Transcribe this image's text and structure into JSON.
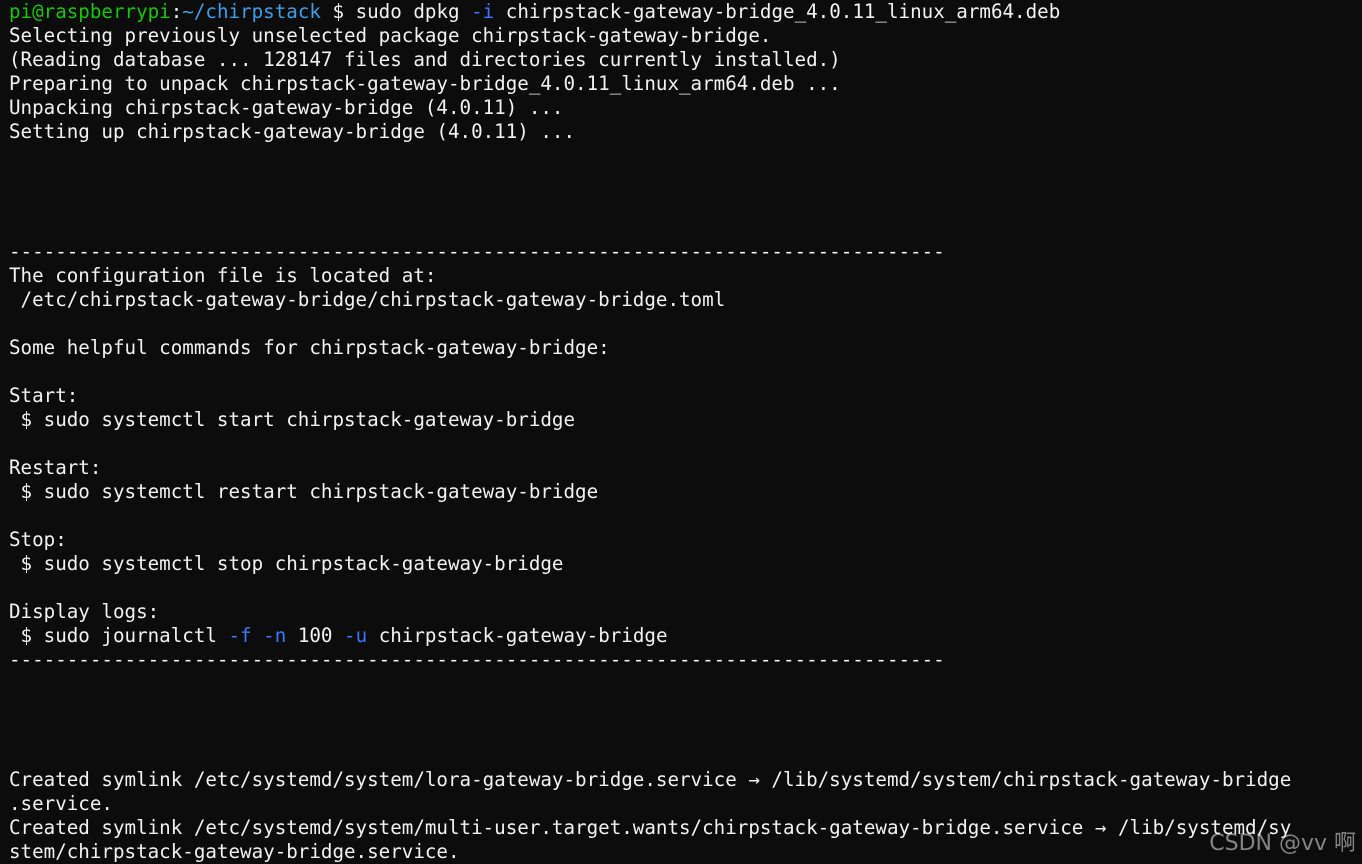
{
  "prompt": {
    "user_host": "pi@raspberrypi",
    "separator": ":",
    "cwd": "~/chirpstack",
    "symbol": " $ ",
    "cmd_1": "sudo dpkg ",
    "flag": "-i",
    "cmd_2": " chirpstack-gateway-bridge_4.0.11_linux_arm64.deb"
  },
  "output": {
    "l1": "Selecting previously unselected package chirpstack-gateway-bridge.",
    "l2": "(Reading database ... 128147 files and directories currently installed.)",
    "l3": "Preparing to unpack chirpstack-gateway-bridge_4.0.11_linux_arm64.deb ...",
    "l4": "Unpacking chirpstack-gateway-bridge (4.0.11) ...",
    "l5": "Setting up chirpstack-gateway-bridge (4.0.11) ...",
    "divider": "---------------------------------------------------------------------------------",
    "config_intro": "The configuration file is located at:",
    "config_path": " /etc/chirpstack-gateway-bridge/chirpstack-gateway-bridge.toml",
    "helpful": "Some helpful commands for chirpstack-gateway-bridge:",
    "start_label": "Start:",
    "start_cmd": " $ sudo systemctl start chirpstack-gateway-bridge",
    "restart_label": "Restart:",
    "restart_cmd": " $ sudo systemctl restart chirpstack-gateway-bridge",
    "stop_label": "Stop:",
    "stop_cmd": " $ sudo systemctl stop chirpstack-gateway-bridge",
    "logs_label": "Display logs:",
    "logs_cmd_1": " $ sudo journalctl ",
    "logs_flag_f": "-f",
    "logs_sp1": " ",
    "logs_flag_n": "-n",
    "logs_num": " 100 ",
    "logs_flag_u": "-u",
    "logs_cmd_2": " chirpstack-gateway-bridge",
    "symlink1_a": "Created symlink /etc/systemd/system/lora-gateway-bridge.service → /lib/systemd/system/chirpstack-gateway-bridge",
    "symlink1_b": ".service.",
    "symlink2_a": "Created symlink /etc/systemd/system/multi-user.target.wants/chirpstack-gateway-bridge.service → /lib/systemd/sy",
    "symlink2_b": "stem/chirpstack-gateway-bridge.service."
  },
  "watermark": "CSDN @vv 啊",
  "colors": {
    "background": "#0c0c0c",
    "text": "#f2f2f2",
    "prompt_user": "#16c60c",
    "prompt_path": "#3b9eea",
    "flag": "#3b78ff"
  }
}
